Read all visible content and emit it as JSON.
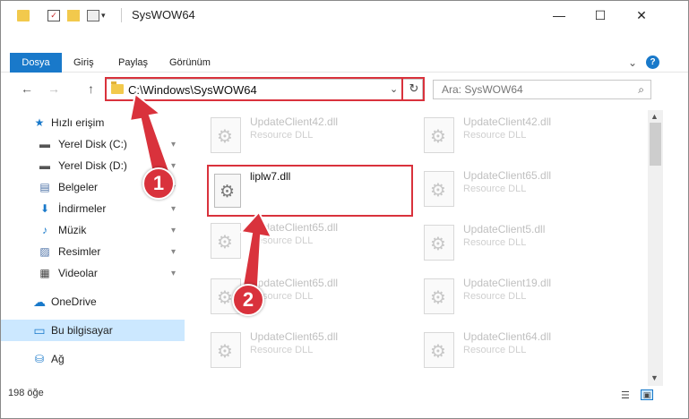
{
  "window": {
    "title": "SysWOW64",
    "minimize": "—",
    "maximize": "☐",
    "close": "✕"
  },
  "ribbon": {
    "tabs": [
      {
        "label": "Dosya"
      },
      {
        "label": "Giriş"
      },
      {
        "label": "Paylaş"
      },
      {
        "label": "Görünüm"
      }
    ],
    "help": "?",
    "expand": "⌄"
  },
  "nav": {
    "back": "←",
    "forward": "→",
    "up": "↑",
    "address": "C:\\Windows\\SysWOW64",
    "dropdown": "⌄",
    "refresh": "↻"
  },
  "search": {
    "placeholder": "Ara: SysWOW64",
    "icon": "⌕"
  },
  "sidebar": {
    "items": [
      {
        "label": "Hızlı erişim",
        "icon": "star-icon",
        "glyph": "★"
      },
      {
        "label": "Yerel Disk (C:)",
        "icon": "drive-icon",
        "glyph": "▬",
        "pin": "📌"
      },
      {
        "label": "Yerel Disk (D:)",
        "icon": "drive-icon",
        "glyph": "▬",
        "pin": "📌"
      },
      {
        "label": "Belgeler",
        "icon": "document-icon",
        "glyph": "▤",
        "pin": "📌"
      },
      {
        "label": "İndirmeler",
        "icon": "download-icon",
        "glyph": "⬇",
        "pin": "📌"
      },
      {
        "label": "Müzik",
        "icon": "music-icon",
        "glyph": "♪",
        "pin": "📌"
      },
      {
        "label": "Resimler",
        "icon": "pictures-icon",
        "glyph": "▨",
        "pin": "📌"
      },
      {
        "label": "Videolar",
        "icon": "video-icon",
        "glyph": "▦",
        "pin": "📌"
      },
      {
        "label": "OneDrive",
        "icon": "cloud-icon",
        "glyph": "☁"
      },
      {
        "label": "Bu bilgisayar",
        "icon": "computer-icon",
        "glyph": "▭"
      },
      {
        "label": "Ağ",
        "icon": "network-icon",
        "glyph": "⛁"
      }
    ]
  },
  "files": {
    "left": [
      {
        "name": "UpdateClient42.dll",
        "type": "Resource DLL"
      },
      {
        "name": "UpdateClient65.dll",
        "type": "Resource DLL"
      },
      {
        "name": "UpdateClient65.dll",
        "type": "Resource DLL"
      },
      {
        "name": "UpdateClient65.dll",
        "type": "Resource DLL"
      }
    ],
    "right": [
      {
        "name": "UpdateClient42.dll",
        "type": "Resource DLL"
      },
      {
        "name": "UpdateClient65.dll",
        "type": "Resource DLL"
      },
      {
        "name": "UpdateClient5.dll",
        "type": "Resource DLL"
      },
      {
        "name": "UpdateClient19.dll",
        "type": "Resource DLL"
      },
      {
        "name": "UpdateClient64.dll",
        "type": "Resource DLL"
      }
    ],
    "highlighted": {
      "name": "liplw7.dll"
    }
  },
  "callouts": {
    "one": "1",
    "two": "2"
  },
  "status": {
    "count": "198 öğe"
  },
  "colors": {
    "accent": "#1979ca",
    "highlight": "#d9323c",
    "selected": "#cce8ff"
  }
}
